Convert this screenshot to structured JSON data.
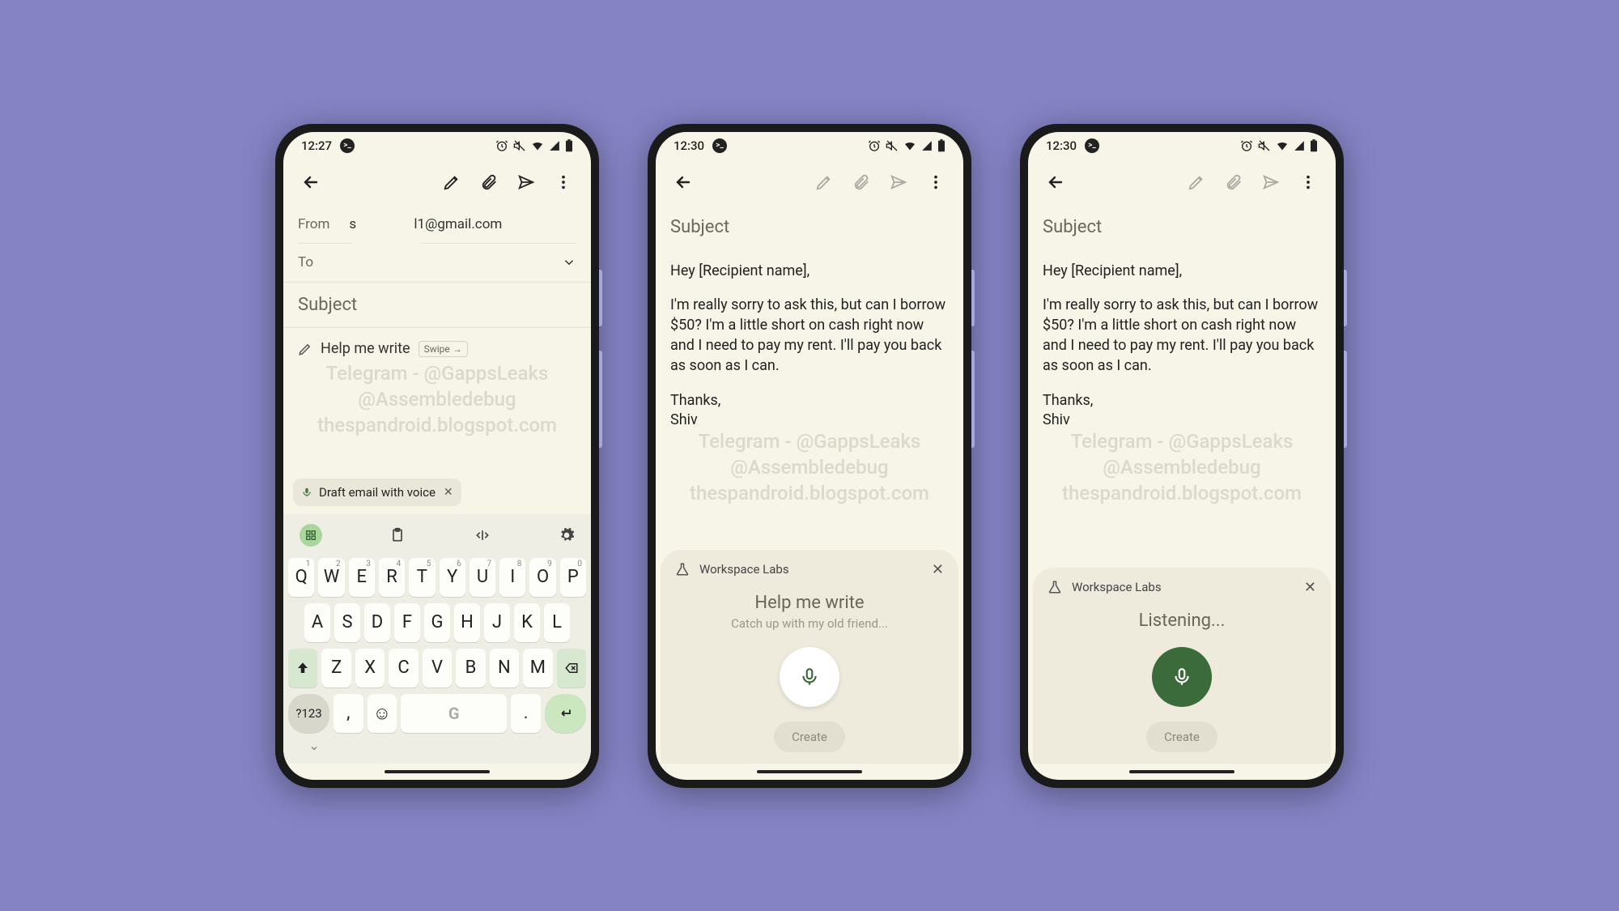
{
  "phone1": {
    "time": "12:27",
    "from_label": "From",
    "from_initial": "s",
    "from_email": "l1@gmail.com",
    "to_label": "To",
    "subject_placeholder": "Subject",
    "help_label": "Help me write",
    "swipe_label": "Swipe →",
    "voice_chip": "Draft email with voice",
    "watermark": {
      "l1": "Telegram - @GappsLeaks",
      "l2": "@Assembledebug",
      "l3": "thespandroid.blogspot.com"
    },
    "keyboard": {
      "row1": [
        [
          "Q",
          "1"
        ],
        [
          "W",
          "2"
        ],
        [
          "E",
          "3"
        ],
        [
          "R",
          "4"
        ],
        [
          "T",
          "5"
        ],
        [
          "Y",
          "6"
        ],
        [
          "U",
          "7"
        ],
        [
          "I",
          "8"
        ],
        [
          "O",
          "9"
        ],
        [
          "P",
          "0"
        ]
      ],
      "row2": [
        "A",
        "S",
        "D",
        "F",
        "G",
        "H",
        "J",
        "K",
        "L"
      ],
      "row3": [
        "Z",
        "X",
        "C",
        "V",
        "B",
        "N",
        "M"
      ],
      "sym": "?123",
      "comma": ",",
      "period": "."
    }
  },
  "phone2": {
    "time": "12:30",
    "subject_placeholder": "Subject",
    "body": {
      "greeting": "Hey [Recipient name],",
      "para": "I'm really sorry to ask this, but can I borrow $50? I'm a little short on cash right now and I need to pay my rent. I'll pay you back as soon as I can.",
      "thanks": "Thanks,",
      "sign": "Shiv"
    },
    "watermark": {
      "l1": "Telegram - @GappsLeaks",
      "l2": "@Assembledebug",
      "l3": "thespandroid.blogspot.com"
    },
    "labs": {
      "brand": "Workspace Labs",
      "title": "Help me write",
      "sub": "Catch up with my old friend...",
      "create": "Create"
    }
  },
  "phone3": {
    "time": "12:30",
    "subject_placeholder": "Subject",
    "body": {
      "greeting": "Hey [Recipient name],",
      "para": "I'm really sorry to ask this, but can I borrow $50? I'm a little short on cash right now and I need to pay my rent. I'll pay you back as soon as I can.",
      "thanks": "Thanks,",
      "sign": "Shiv"
    },
    "watermark": {
      "l1": "Telegram - @GappsLeaks",
      "l2": "@Assembledebug",
      "l3": "thespandroid.blogspot.com"
    },
    "labs": {
      "brand": "Workspace Labs",
      "listening": "Listening...",
      "create": "Create"
    }
  }
}
